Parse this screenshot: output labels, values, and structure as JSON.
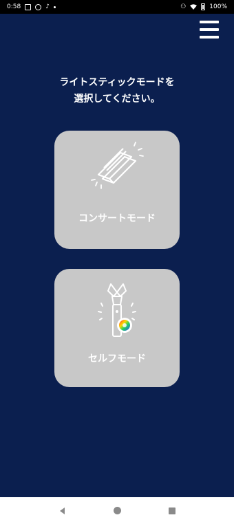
{
  "status_bar": {
    "time": "0:58",
    "battery": "100%"
  },
  "prompt": {
    "line1": "ライトスティックモードを",
    "line2": "選択してください。"
  },
  "modes": {
    "concert_label": "コンサートモード",
    "self_label": "セルフモード"
  },
  "icons": {
    "menu": "hamburger-menu-icon",
    "concert": "concert-lightstick-icon",
    "self": "lightstick-color-wheel-icon"
  },
  "colors": {
    "background": "#0b1f4f",
    "card": "#c8c8c8",
    "text": "#ffffff"
  }
}
